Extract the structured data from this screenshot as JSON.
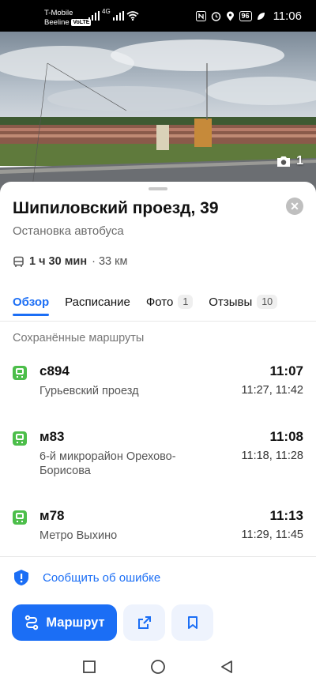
{
  "status_bar": {
    "carrier1": "T-Mobile",
    "carrier2": "Beeline",
    "volte": "VoLTE",
    "network": "4G",
    "battery": "96",
    "time": "11:06"
  },
  "photo": {
    "count": "1"
  },
  "place": {
    "title": "Шипиловский проезд, 39",
    "subtitle": "Остановка автобуса",
    "travel_time": "1 ч 30 мин",
    "travel_distance": "· 33 км"
  },
  "tabs": [
    {
      "label": "Обзор",
      "count": ""
    },
    {
      "label": "Расписание",
      "count": ""
    },
    {
      "label": "Фото",
      "count": "1"
    },
    {
      "label": "Отзывы",
      "count": "10"
    }
  ],
  "saved_routes": {
    "label": "Сохранённые маршруты",
    "routes": [
      {
        "number": "с894",
        "destination": "Гурьевский проезд",
        "next": "11:07",
        "later": "11:27, 11:42"
      },
      {
        "number": "м83",
        "destination": "6-й микрорайон Орехово-Борисова",
        "next": "11:08",
        "later": "11:18, 11:28"
      },
      {
        "number": "м78",
        "destination": "Метро Выхино",
        "next": "11:13",
        "later": "11:29, 11:45"
      }
    ]
  },
  "report": {
    "label": "Сообщить об ошибке"
  },
  "actions": {
    "route_label": "Маршрут"
  },
  "colors": {
    "accent": "#1b6ef5",
    "bus_green": "#4cbe4a"
  }
}
